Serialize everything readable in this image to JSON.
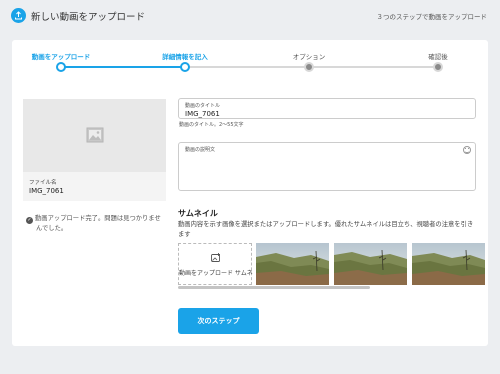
{
  "header": {
    "title": "新しい動画をアップロード",
    "right_text": "３つのステップで動画をアップロード"
  },
  "steps": [
    {
      "label": "動画をアップロード",
      "state": "done"
    },
    {
      "label": "詳細情報を記入",
      "state": "current"
    },
    {
      "label": "オプション",
      "state": "todo"
    },
    {
      "label": "確認後",
      "state": "todo"
    }
  ],
  "preview": {
    "file_label": "ファイル名",
    "file_name": "IMG_7061"
  },
  "status": {
    "line1": "動画アップロード完了。問題は見つかりませ",
    "line2": "んでした。"
  },
  "title_field": {
    "label": "動画のタイトル",
    "value": "IMG_7061",
    "hint": "動画のタイトル。2〜55文字"
  },
  "description_field": {
    "label": "動画の説明文",
    "value": ""
  },
  "thumbnail": {
    "heading": "サムネイル",
    "description": "動画内容を示す画像を選択またはアップロードします。優れたサムネイルは目立ち、視聴者の注意を引きます",
    "upload_label": "動画をアップロード サムネイル"
  },
  "next_button": "次のステップ",
  "colors": {
    "accent": "#1aa3e8",
    "background": "#eceef1"
  }
}
